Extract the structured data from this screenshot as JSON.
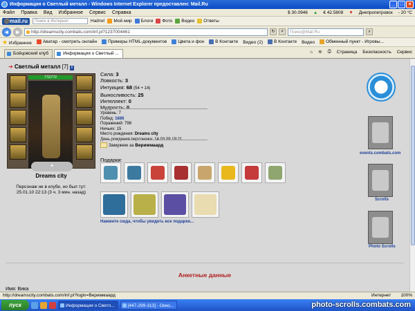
{
  "window": {
    "title": "Информация о Светлый металл - Windows Internet Explorer предоставлен: Mail.Ru"
  },
  "menu": {
    "items": [
      "Файл",
      "Правка",
      "Вид",
      "Избранное",
      "Сервис",
      "Справка"
    ],
    "usd": "$ 30.0946",
    "eur": "€ 42.5808",
    "city": "Днепропетровск",
    "temp": "- 20 °C"
  },
  "mailbar": {
    "logo_prefix": "@",
    "logo_text": "mail.ru",
    "search_placeholder": "Поиск в Интернет",
    "find_label": "Найти!",
    "buttons": [
      "Мой мир",
      "Блоги",
      "Фото",
      "Видео",
      "Ответы"
    ]
  },
  "address": {
    "url": "http://dreamscity.combats.com/inf.pl?1237004461",
    "search_placeholder": "Поиск@Mail.Ru"
  },
  "favorites": {
    "label": "Избранное",
    "links": [
      "Аватар - смотреть онлайн",
      "Примеры HTML-документов",
      "Цвета и фон",
      "В Контакте",
      "Видео (2)",
      "В Контакте",
      "Видео",
      "Обменный пункт - Игровы..."
    ]
  },
  "tabs": [
    {
      "label": "Бойцовский клуб"
    },
    {
      "label": "Информация о Светлый ..."
    }
  ],
  "tools": {
    "page": "Страница",
    "security": "Безопасность",
    "service": "Сервис"
  },
  "character": {
    "name": "Светлый металл",
    "level": "[7]",
    "hp": "772/772",
    "city": "Dreams city",
    "club_note": "Персонаж не в клубе, но был тут:",
    "last_seen": "25.01.10 22:13 (3 ч. 3 мин. назад)",
    "stats": [
      {
        "label": "Сила:",
        "value": "3",
        "extra": ""
      },
      {
        "label": "Ловкость:",
        "value": "3",
        "extra": ""
      },
      {
        "label": "Интуиция:",
        "value": "68",
        "extra": "(54 + 14)"
      },
      {
        "label": "Выносливость:",
        "value": "25",
        "extra": ""
      },
      {
        "label": "Интеллект:",
        "value": "0",
        "extra": ""
      },
      {
        "label": "Мудрость:",
        "value": "0",
        "extra": ""
      }
    ],
    "details": {
      "level_label": "Уровень:",
      "level_value": "7",
      "wins_label": "Побед:",
      "wins_value": "1886",
      "losses_label": "Поражений:",
      "losses_value": "798",
      "draws_label": "Ничьих:",
      "draws_value": "15",
      "birthplace_label": "Место рождения:",
      "birthplace_value": "Dreams city",
      "birthday_label": "День рождения персонажа:",
      "birthday_value": "14.03.09 19:21"
    },
    "married_prefix": "Замужем за",
    "married_name": "Вериммаард"
  },
  "gifts": {
    "label": "Подарки:",
    "more_link": "Нажмите сюда, чтобы увидеть все подарки..."
  },
  "side": {
    "banner1": "events.combats.com",
    "banner2": "Scrolls",
    "banner3": "Photo Scrolls"
  },
  "section": {
    "title": "Анкетные данные",
    "name_label": "Имя:",
    "name_value": "Вика"
  },
  "status": {
    "url": "http://dreamscity.combats.com/inf.pl?login=Вериммаард",
    "zone": "Интернет",
    "zoom": "100%"
  },
  "taskbar": {
    "start": "пуск",
    "items": [
      "Информация о Светл...",
      "[447-299-313] - Окно..."
    ],
    "watermark": "photo-scrolls.combats.com"
  }
}
